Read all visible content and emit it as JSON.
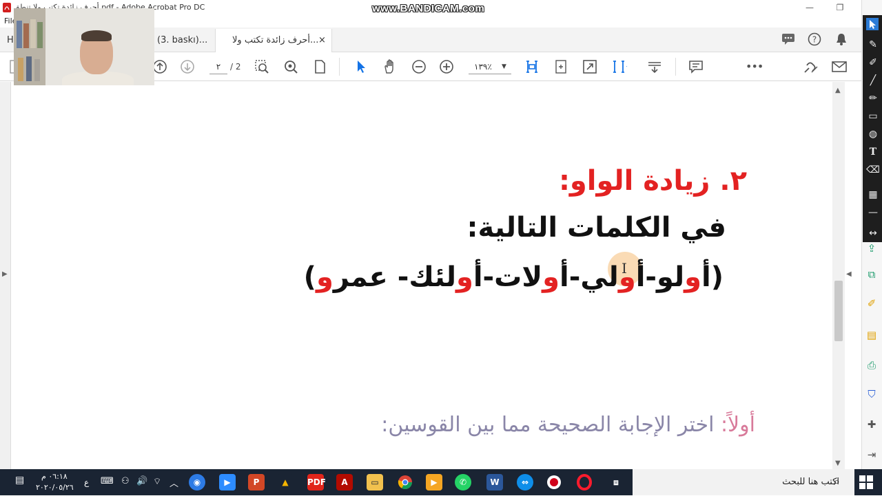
{
  "window": {
    "title": "أحرف زائدة تكتب ولا تنطق.pdf - Adobe Acrobat Pro DC",
    "watermark": "www.BANDICAM.com",
    "minimize": "—",
    "restore": "❐"
  },
  "menu": {
    "file": "File"
  },
  "tabs": [
    {
      "label": "H"
    },
    {
      "label": "(3. baskı)..."
    },
    {
      "label": "أحرف زائدة تكتب ولا...",
      "active": true,
      "close": "×"
    }
  ],
  "toolbar": {
    "current_page": "٢",
    "page_count": "/ 2",
    "zoom": "١٣٩٪",
    "more": "•••"
  },
  "document": {
    "heading": "٢.   زيادة الواو:",
    "subheading": "في الكلمات التالية:",
    "words": [
      {
        "t": "(أ",
        "red": false
      },
      {
        "t": "و",
        "red": true
      },
      {
        "t": "لو-أ",
        "red": false
      },
      {
        "t": "و",
        "red": true
      },
      {
        "t": "لي-أ",
        "red": false
      },
      {
        "t": "و",
        "red": true
      },
      {
        "t": "لات-أ",
        "red": false
      },
      {
        "t": "و",
        "red": true
      },
      {
        "t": "لئك- عمر",
        "red": false
      },
      {
        "t": "و",
        "red": true
      },
      {
        "t": ")",
        "red": false
      }
    ],
    "question_label": "أولاً:",
    "question_text": " اختر الإجابة الصحيحة مما بين القوسين:"
  },
  "taskbar": {
    "search_placeholder": "اكتب هنا للبحث",
    "time": "٠٦:١٨ م",
    "date": "٢٠٢٠/٠٥/٢٦",
    "language": "ع",
    "colors": {
      "background": "#1a2433",
      "search_bg": "#f2f2f2"
    }
  },
  "colors": {
    "red_text": "#e32222",
    "question_text": "#8a86a8",
    "question_label": "#d87a9a",
    "annot_strip": "#1e1e1e"
  }
}
